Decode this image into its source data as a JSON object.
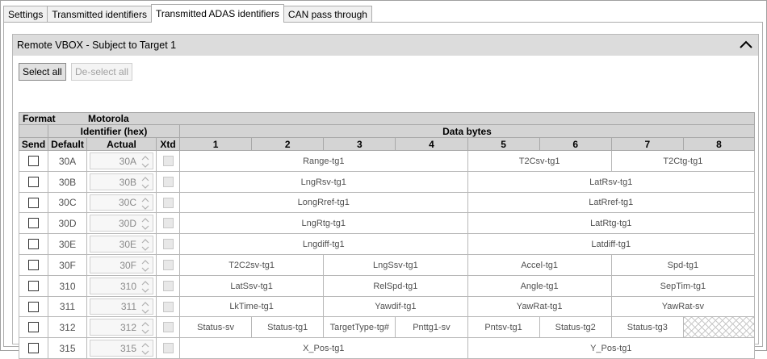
{
  "tabs": [
    {
      "label": "Settings",
      "active": false
    },
    {
      "label": "Transmitted identifiers",
      "active": false
    },
    {
      "label": "Transmitted ADAS identifiers",
      "active": true
    },
    {
      "label": "CAN pass through",
      "active": false
    }
  ],
  "group": {
    "title": "Remote VBOX - Subject to Target 1",
    "collapse_icon": "chevron-up-icon"
  },
  "buttons": {
    "select_all": "Select all",
    "deselect_all": "De-select all"
  },
  "table": {
    "format_label": "Format",
    "format_value": "Motorola",
    "identifier_header": "Identifier (hex)",
    "data_bytes_header": "Data bytes",
    "columns": {
      "send": "Send",
      "default": "Default",
      "actual": "Actual",
      "xtd": "Xtd",
      "bytes": [
        "1",
        "2",
        "3",
        "4",
        "5",
        "6",
        "7",
        "8"
      ]
    },
    "rows": [
      {
        "default": "30A",
        "actual": "30A",
        "signals": [
          {
            "name": "Range-tg1",
            "span": 4
          },
          {
            "name": "T2Csv-tg1",
            "span": 2
          },
          {
            "name": "T2Ctg-tg1",
            "span": 2
          }
        ]
      },
      {
        "default": "30B",
        "actual": "30B",
        "signals": [
          {
            "name": "LngRsv-tg1",
            "span": 4
          },
          {
            "name": "LatRsv-tg1",
            "span": 4
          }
        ]
      },
      {
        "default": "30C",
        "actual": "30C",
        "signals": [
          {
            "name": "LongRref-tg1",
            "span": 4
          },
          {
            "name": "LatRref-tg1",
            "span": 4
          }
        ]
      },
      {
        "default": "30D",
        "actual": "30D",
        "signals": [
          {
            "name": "LngRtg-tg1",
            "span": 4
          },
          {
            "name": "LatRtg-tg1",
            "span": 4
          }
        ]
      },
      {
        "default": "30E",
        "actual": "30E",
        "signals": [
          {
            "name": "Lngdiff-tg1",
            "span": 4
          },
          {
            "name": "Latdiff-tg1",
            "span": 4
          }
        ]
      },
      {
        "default": "30F",
        "actual": "30F",
        "signals": [
          {
            "name": "T2C2sv-tg1",
            "span": 2
          },
          {
            "name": "LngSsv-tg1",
            "span": 2
          },
          {
            "name": "Accel-tg1",
            "span": 2
          },
          {
            "name": "Spd-tg1",
            "span": 2
          }
        ]
      },
      {
        "default": "310",
        "actual": "310",
        "signals": [
          {
            "name": "LatSsv-tg1",
            "span": 2
          },
          {
            "name": "RelSpd-tg1",
            "span": 2
          },
          {
            "name": "Angle-tg1",
            "span": 2
          },
          {
            "name": "SepTim-tg1",
            "span": 2
          }
        ]
      },
      {
        "default": "311",
        "actual": "311",
        "signals": [
          {
            "name": "LkTime-tg1",
            "span": 2
          },
          {
            "name": "Yawdif-tg1",
            "span": 2
          },
          {
            "name": "YawRat-tg1",
            "span": 2
          },
          {
            "name": "YawRat-sv",
            "span": 2
          }
        ]
      },
      {
        "default": "312",
        "actual": "312",
        "signals": [
          {
            "name": "Status-sv",
            "span": 1
          },
          {
            "name": "Status-tg1",
            "span": 1
          },
          {
            "name": "TargetType-tg#",
            "span": 1
          },
          {
            "name": "Pnttg1-sv",
            "span": 1
          },
          {
            "name": "Pntsv-tg1",
            "span": 1
          },
          {
            "name": "Status-tg2",
            "span": 1
          },
          {
            "name": "Status-tg3",
            "span": 1
          },
          {
            "name": "",
            "span": 1,
            "unused": true
          }
        ]
      },
      {
        "default": "315",
        "actual": "315",
        "signals": [
          {
            "name": "X_Pos-tg1",
            "span": 4
          },
          {
            "name": "Y_Pos-tg1",
            "span": 4
          }
        ]
      }
    ]
  },
  "colors": {
    "header_bg": "#d4d4d4",
    "group_header_bg": "#dcdcdc",
    "cell_text": "#505050"
  }
}
